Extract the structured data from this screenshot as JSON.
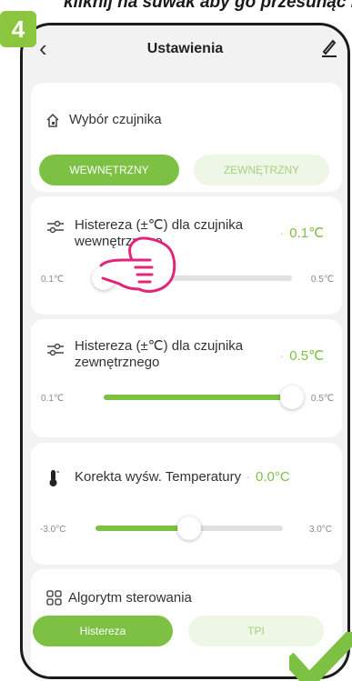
{
  "step_number": "4",
  "instruction_text": "kliknij na suwak aby go przesunąć i ustawić histerezę",
  "header": {
    "title": "Ustawienia",
    "back_icon": "chevron-left-icon",
    "edit_icon": "pencil-icon"
  },
  "sensor": {
    "label": "Wybór czujnika",
    "icon": "home-sensor-icon",
    "options": [
      "WEWNĘTRZNY",
      "ZEWNĘTRZNY"
    ],
    "selected": "WEWNĘTRZNY"
  },
  "hysteresis_internal": {
    "icon": "hysteresis-icon",
    "label_line1": "Histereza (±℃) dla czujnika",
    "label_line2": "wewnętrznego",
    "value": "0.1℃",
    "min_label": "0.1℃",
    "max_label": "0.5℃",
    "level": 0
  },
  "hysteresis_external": {
    "icon": "hysteresis-icon",
    "label_line1": "Histereza (±℃) dla czujnika",
    "label_line2": "zewnętrznego",
    "value": "0.5℃",
    "min_label": "0.1℃",
    "max_label": "0.5℃",
    "level": 1
  },
  "temp_correction": {
    "icon": "thermometer-icon",
    "label": "Korekta wyśw. Temperatury",
    "value": "0.0°C",
    "min_label": "-3.0°C",
    "max_label": "3.0°C",
    "level": 0.5
  },
  "algorithm": {
    "label": "Algorytm sterowania",
    "icon": "grid-icon",
    "options": [
      "Histereza",
      "TPI"
    ],
    "selected": "Histereza"
  },
  "colors": {
    "accent": "#7cc144",
    "badge": "#8cc63f",
    "hand": "#e0257a",
    "background": "#f2f2f3"
  }
}
